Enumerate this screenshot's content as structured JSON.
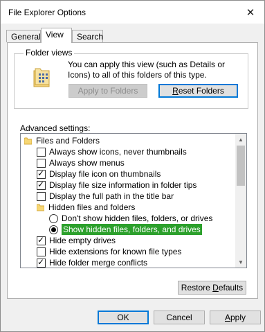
{
  "window": {
    "title": "File Explorer Options",
    "close_glyph": "✕"
  },
  "tabs": [
    {
      "label": "General"
    },
    {
      "label": "View",
      "active": true
    },
    {
      "label": "Search"
    }
  ],
  "folder_views": {
    "label": "Folder views",
    "description": "You can apply this view (such as Details or Icons) to all of this folders of this type.",
    "apply_button": "Apply to Folders",
    "reset_button_hotkey": "R",
    "reset_button_rest": "eset Folders"
  },
  "advanced": {
    "label": "Advanced settings:",
    "items": [
      {
        "kind": "folder",
        "label": "Files and Folders"
      },
      {
        "kind": "checkbox",
        "label": "Always show icons, never thumbnails",
        "checked": false
      },
      {
        "kind": "checkbox",
        "label": "Always show menus",
        "checked": false
      },
      {
        "kind": "checkbox",
        "label": "Display file icon on thumbnails",
        "checked": true
      },
      {
        "kind": "checkbox",
        "label": "Display file size information in folder tips",
        "checked": true
      },
      {
        "kind": "checkbox",
        "label": "Display the full path in the title bar",
        "checked": false
      },
      {
        "kind": "folder",
        "label": "Hidden files and folders"
      },
      {
        "kind": "radio",
        "label": "Don't show hidden files, folders, or drives",
        "selected": false
      },
      {
        "kind": "radio",
        "label": "Show hidden files, folders, and drives",
        "selected": true
      },
      {
        "kind": "checkbox",
        "label": "Hide empty drives",
        "checked": true
      },
      {
        "kind": "checkbox",
        "label": "Hide extensions for known file types",
        "checked": false
      },
      {
        "kind": "checkbox",
        "label": "Hide folder merge conflicts",
        "checked": true
      }
    ],
    "check_glyph": "✓",
    "scroll_up": "▲",
    "scroll_down": "▼"
  },
  "restore_defaults": {
    "pre": "Restore ",
    "hotkey": "D",
    "post": "efaults"
  },
  "footer": {
    "ok": "OK",
    "cancel": "Cancel",
    "apply_hotkey": "A",
    "apply_rest": "pply"
  },
  "colors": {
    "accent": "#0078d7",
    "highlight": "#2ca02c"
  }
}
